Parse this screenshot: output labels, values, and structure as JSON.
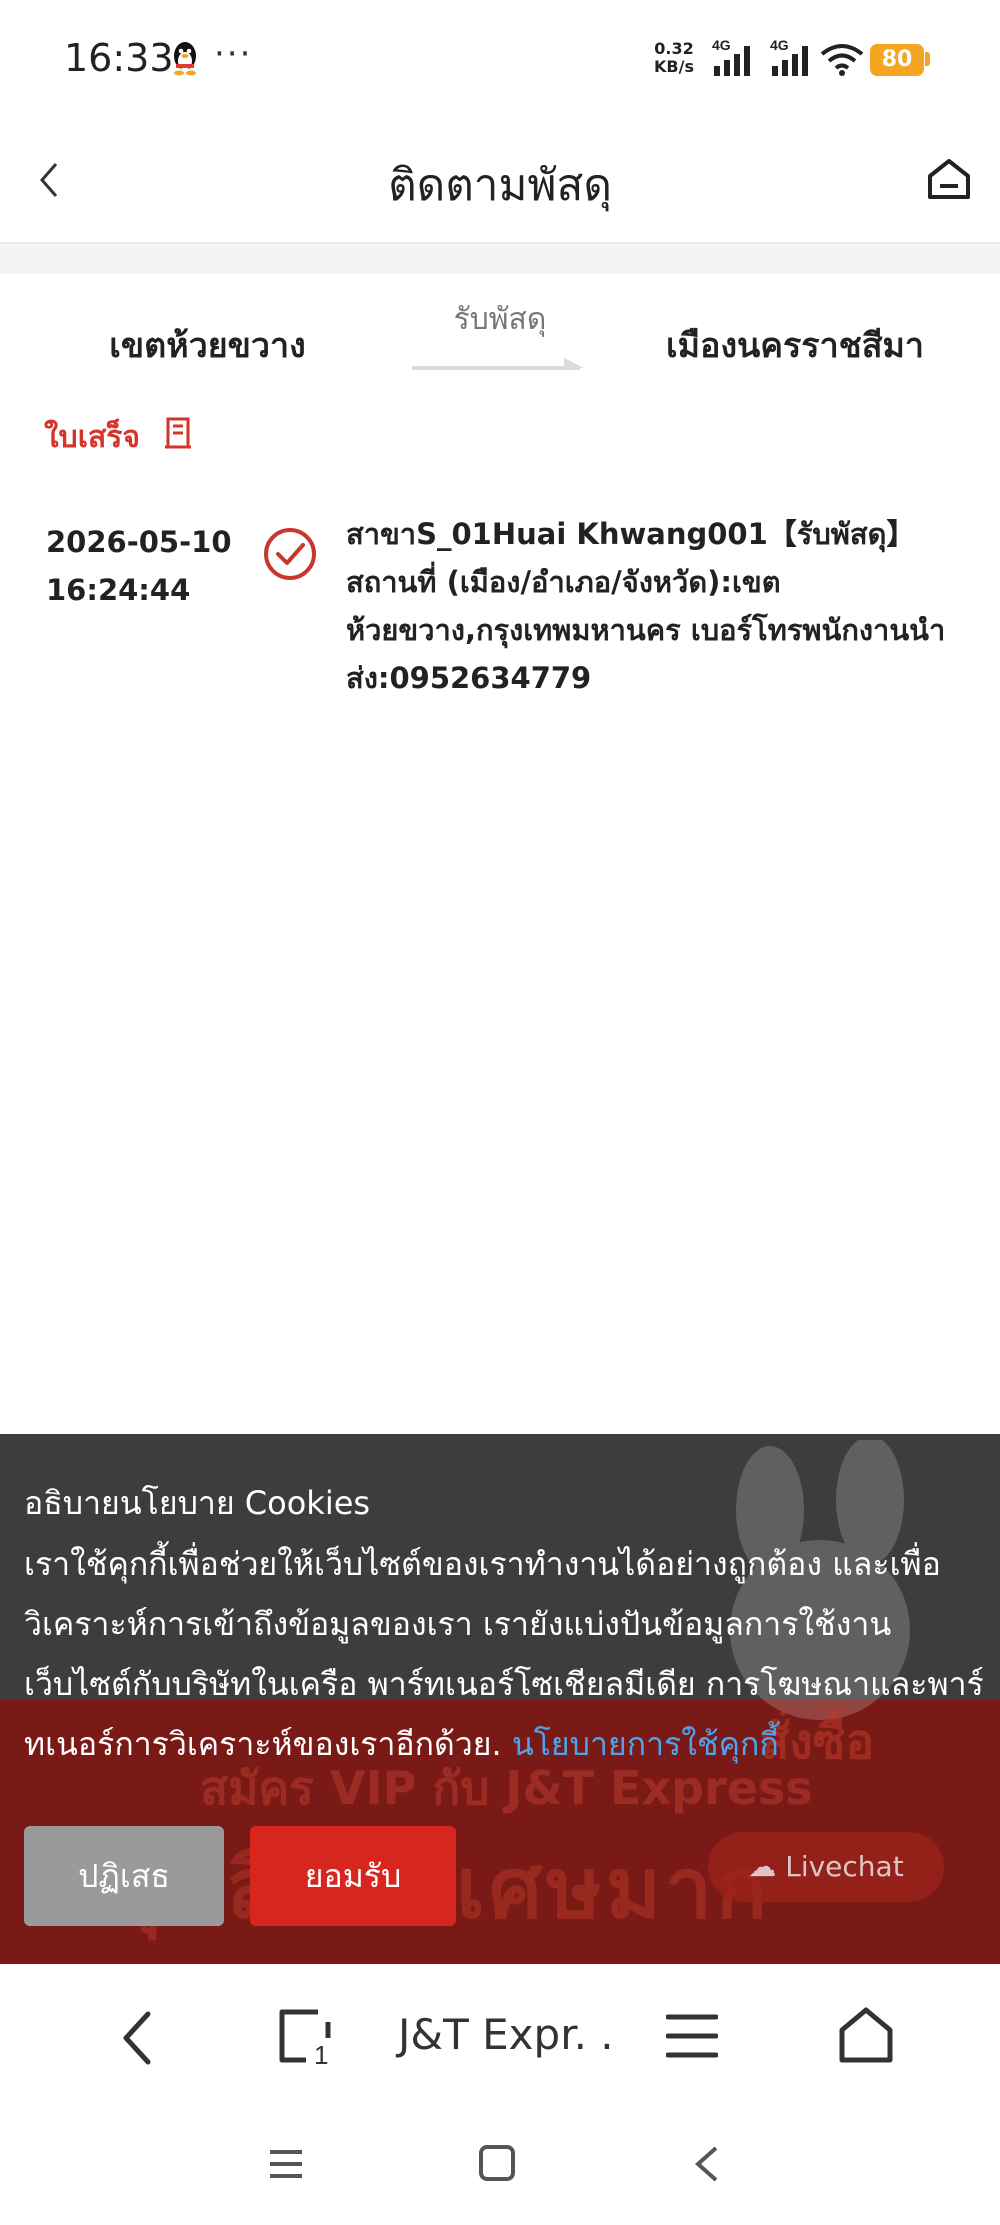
{
  "status_bar": {
    "time": "16:33",
    "more": "···",
    "net_speed": "0.32",
    "net_unit": "KB/s",
    "net_type_1": "4G",
    "net_type_2": "4G",
    "battery": "80"
  },
  "header": {
    "title": "ติดตามพัสดุ"
  },
  "route": {
    "from": "เขตห้วยขวาง",
    "status": "รับพัสดุ",
    "to": "เมืองนครราชสีมา"
  },
  "receipt_label": "ใบเสร็จ",
  "timeline": [
    {
      "date": "2026-05-10",
      "time": "16:24:44",
      "detail": "สาขาS_01Huai Khwang001【รับพัสดุ】สถานที่ (เมือง/อำเภอ/จังหวัด):เขตห้วยขวาง,กรุงเทพมหานคร เบอร์โทรพนักงานนำส่ง:0952634779"
    }
  ],
  "promo": {
    "line1": "สมัคร VIP กับ J&T Express",
    "line2": "ลุ้นสิทธิพิเศษมาก",
    "order": "สั่งซื้อ",
    "livechat": "Livechat"
  },
  "cookie": {
    "title": "อธิบายนโยบาย Cookies",
    "body": "เราใช้คุกกี้เพื่อช่วยให้เว็บไซต์ของเราทำงานได้อย่างถูกต้อง และเพื่อวิเคราะห์การเข้าถึงข้อมูลของเรา เรายังแบ่งปันข้อมูลการใช้งานเว็บไซต์กับบริษัทในเครือ พาร์ทเนอร์โซเชียลมีเดีย การโฆษณาและพาร์ทเนอร์การวิเคราะห์ของเราอีกด้วย. ",
    "link": "นโยบายการใช้คุกกี้",
    "reject": "ปฏิเสธ",
    "accept": "ยอมรับ"
  },
  "browser": {
    "title": "J&T Expr. .",
    "tab_count": "1"
  },
  "colors": {
    "accent_red": "#d7261e",
    "link_blue": "#4ea3f0",
    "battery": "#f4a623"
  }
}
